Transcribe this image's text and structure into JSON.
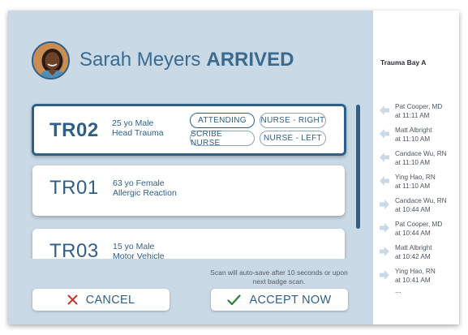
{
  "header": {
    "patient_name": "Sarah Meyers",
    "status": "ARRIVED"
  },
  "rooms": [
    {
      "id": "TR02",
      "line1": "25 yo Male",
      "line2": "Head Trauma",
      "selected": true,
      "roles": [
        "ATTENDING",
        "NURSE - RIGHT",
        "SCRIBE NURSE",
        "NURSE - LEFT"
      ]
    },
    {
      "id": "TR01",
      "line1": "63 yo Female",
      "line2": "Allergic Reaction",
      "selected": false
    },
    {
      "id": "TR03",
      "line1": "15 yo Male",
      "line2": "Motor Vehicle",
      "selected": false
    }
  ],
  "note": "Scan will auto-save after 10 seconds or upon next badge scan.",
  "actions": {
    "cancel_label": "CANCEL",
    "accept_label": "ACCEPT NOW"
  },
  "activity": {
    "title": "Trauma Bay A",
    "entries": [
      {
        "name": "Pat Cooper, MD",
        "time": "at 11:11 AM",
        "direction": "in"
      },
      {
        "name": "Matt Albright",
        "time": "at 11:10 AM",
        "direction": "in"
      },
      {
        "name": "Candace Wu, RN",
        "time": "at 11:10 AM",
        "direction": "in"
      },
      {
        "name": "Ying Hao, RN",
        "time": "at 11:10 AM",
        "direction": "in"
      },
      {
        "name": "Candace Wu, RN",
        "time": "at 10:44 AM",
        "direction": "out"
      },
      {
        "name": "Pat Cooper, MD",
        "time": "at 10:44 AM",
        "direction": "out"
      },
      {
        "name": "Matt Albright",
        "time": "at 10:42 AM",
        "direction": "out"
      },
      {
        "name": "Ying Hao, RN",
        "time": "at 10:41 AM",
        "direction": "out"
      }
    ],
    "more": "..."
  },
  "colors": {
    "background": "#c9d9e6",
    "accent": "#2f5f88",
    "cancel_icon": "#c0392b",
    "accept_icon": "#2e7d32",
    "arrow": "#c9d9e6"
  },
  "icons": {
    "cancel": "close-icon",
    "accept": "checkmark-icon",
    "entry_in": "arrow-left-icon",
    "entry_out": "arrow-right-icon"
  }
}
